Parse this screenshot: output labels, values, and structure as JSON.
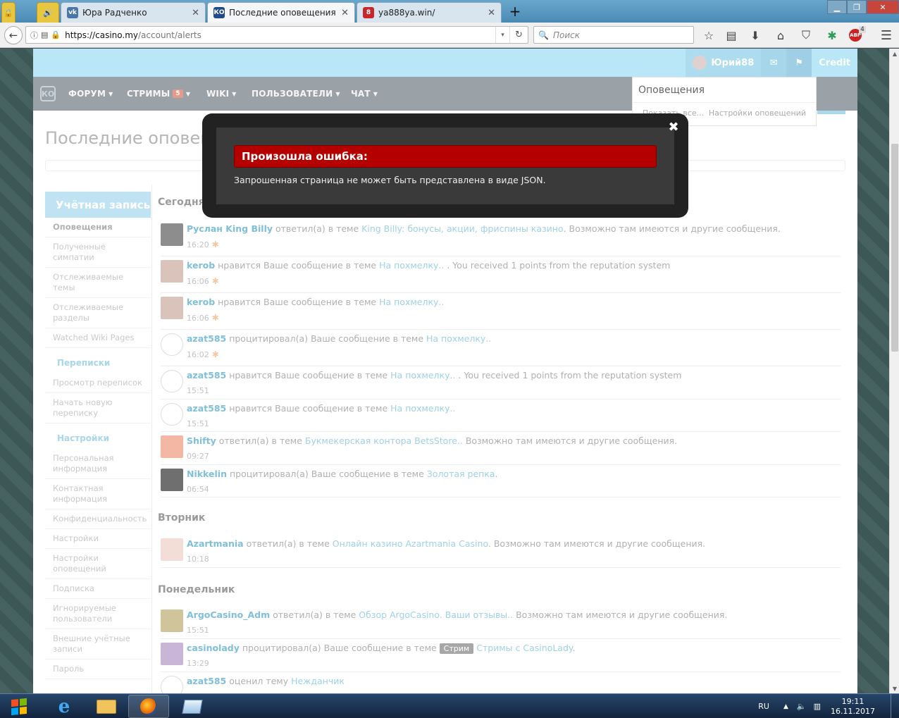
{
  "browser": {
    "tabs": [
      {
        "title": "Юра Радченко",
        "icon": "vk-icon",
        "active": false
      },
      {
        "title": "Последние оповещения | Ф",
        "icon": "site-icon",
        "active": true
      },
      {
        "title": "ya888ya.win/",
        "icon": "site-8-icon",
        "active": false
      }
    ],
    "new_tab_icon": "plus-icon",
    "url_domain": "https://casino.my",
    "url_path": "/account/alerts",
    "search_placeholder": "Поиск",
    "adblock_count": "4"
  },
  "site": {
    "logo_text": "КО",
    "menu": [
      {
        "label": "ФОРУМ"
      },
      {
        "label": "СТРИМЫ",
        "badge": "5"
      },
      {
        "label": "WIKI"
      },
      {
        "label": "ПОЛЬЗОВАТЕЛИ"
      },
      {
        "label": "ЧАТ"
      }
    ],
    "user": {
      "name": "Юрий88",
      "credit_label": "Credit"
    },
    "alert_popup": {
      "title": "Оповещения",
      "show_all": "Показать все...",
      "settings": "Настройки оповещений"
    },
    "page_title": "Последние оповещения"
  },
  "sidebar": {
    "account_heading": "Учётная запись",
    "account_items": [
      "Оповещения",
      "Полученные симпатии",
      "Отслеживаемые темы",
      "Отслеживаемые разделы",
      "Watched Wiki Pages"
    ],
    "conversations_heading": "Переписки",
    "conversations_items": [
      "Просмотр переписок",
      "Начать новую переписку"
    ],
    "settings_heading": "Настройки",
    "settings_items": [
      "Персональная информация",
      "Контактная информация",
      "Конфиденциальность",
      "Настройки",
      "Настройки оповещений",
      "Подписка",
      "Игнорируемые пользователи",
      "Внешние учётные записи",
      "Пароль"
    ]
  },
  "alerts": {
    "groups": [
      {
        "day": "Сегодня",
        "items": [
          {
            "user": "Руслан King Billy",
            "action": " ответил(а) в теме ",
            "link": "King Billy: бонусы, акции, фриспины казино",
            "tail": ". Возможно там имеются и другие сообщения.",
            "time": "16:20",
            "unread": true
          },
          {
            "user": "kerob",
            "action": " нравится Ваше сообщение в теме ",
            "link": "На похмелку..",
            "tail": " . You received 1 points from the reputation system",
            "time": "16:06",
            "unread": true
          },
          {
            "user": "kerob",
            "action": " нравится Ваше сообщение в теме ",
            "link": "На похмелку..",
            "tail": "",
            "time": "16:06",
            "unread": true
          },
          {
            "user": "azat585",
            "action": " процитировал(а) Ваше сообщение в теме ",
            "link": "На похмелку..",
            "tail": "",
            "time": "16:02",
            "unread": true
          },
          {
            "user": "azat585",
            "action": " нравится Ваше сообщение в теме ",
            "link": "На похмелку..",
            "tail": " . You received 1 points from the reputation system",
            "time": "15:51",
            "unread": false
          },
          {
            "user": "azat585",
            "action": " нравится Ваше сообщение в теме ",
            "link": "На похмелку..",
            "tail": "",
            "time": "15:51",
            "unread": false
          },
          {
            "user": "Shifty",
            "action": " ответил(а) в теме ",
            "link": "Букмекерская контора BetsStore..",
            "tail": " Возможно там имеются и другие сообщения.",
            "time": "09:27",
            "unread": false
          },
          {
            "user": "Nikkelin",
            "action": " процитировал(а) Ваше сообщение в теме ",
            "link": "Золотая репка",
            "tail": ".",
            "time": "06:54",
            "unread": false
          }
        ]
      },
      {
        "day": "Вторник",
        "items": [
          {
            "user": "Azartmania",
            "action": " ответил(а) в теме ",
            "link": "Онлайн казино Azartmania Casino",
            "tail": ". Возможно там имеются и другие сообщения.",
            "time": "10:18",
            "unread": false
          }
        ]
      },
      {
        "day": "Понедельник",
        "items": [
          {
            "user": "ArgoCasino_Adm",
            "action": " ответил(а) в теме ",
            "link": "Обзор ArgoCasino. Ваши отзывы..",
            "tail": " Возможно там имеются и другие сообщения.",
            "time": "15:51",
            "unread": false
          },
          {
            "user": "casinolady",
            "action": " процитировал(а) Ваше сообщение в теме ",
            "tag": "Стрим",
            "link": "Стримы с CasinoLady",
            "tail": ".",
            "time": "13:29",
            "unread": false
          },
          {
            "user": "azat585",
            "action": " оценил тему ",
            "link": "Нежданчик",
            "tail": "",
            "time": "",
            "unread": false
          }
        ]
      }
    ]
  },
  "modal": {
    "error_title": "Произошла ошибка:",
    "error_message": "Запрошенная страница не может быть представлена в виде JSON.",
    "close_icon": "close-icon"
  },
  "taskbar": {
    "language": "RU",
    "time": "19:11",
    "date": "16.11.2017"
  }
}
